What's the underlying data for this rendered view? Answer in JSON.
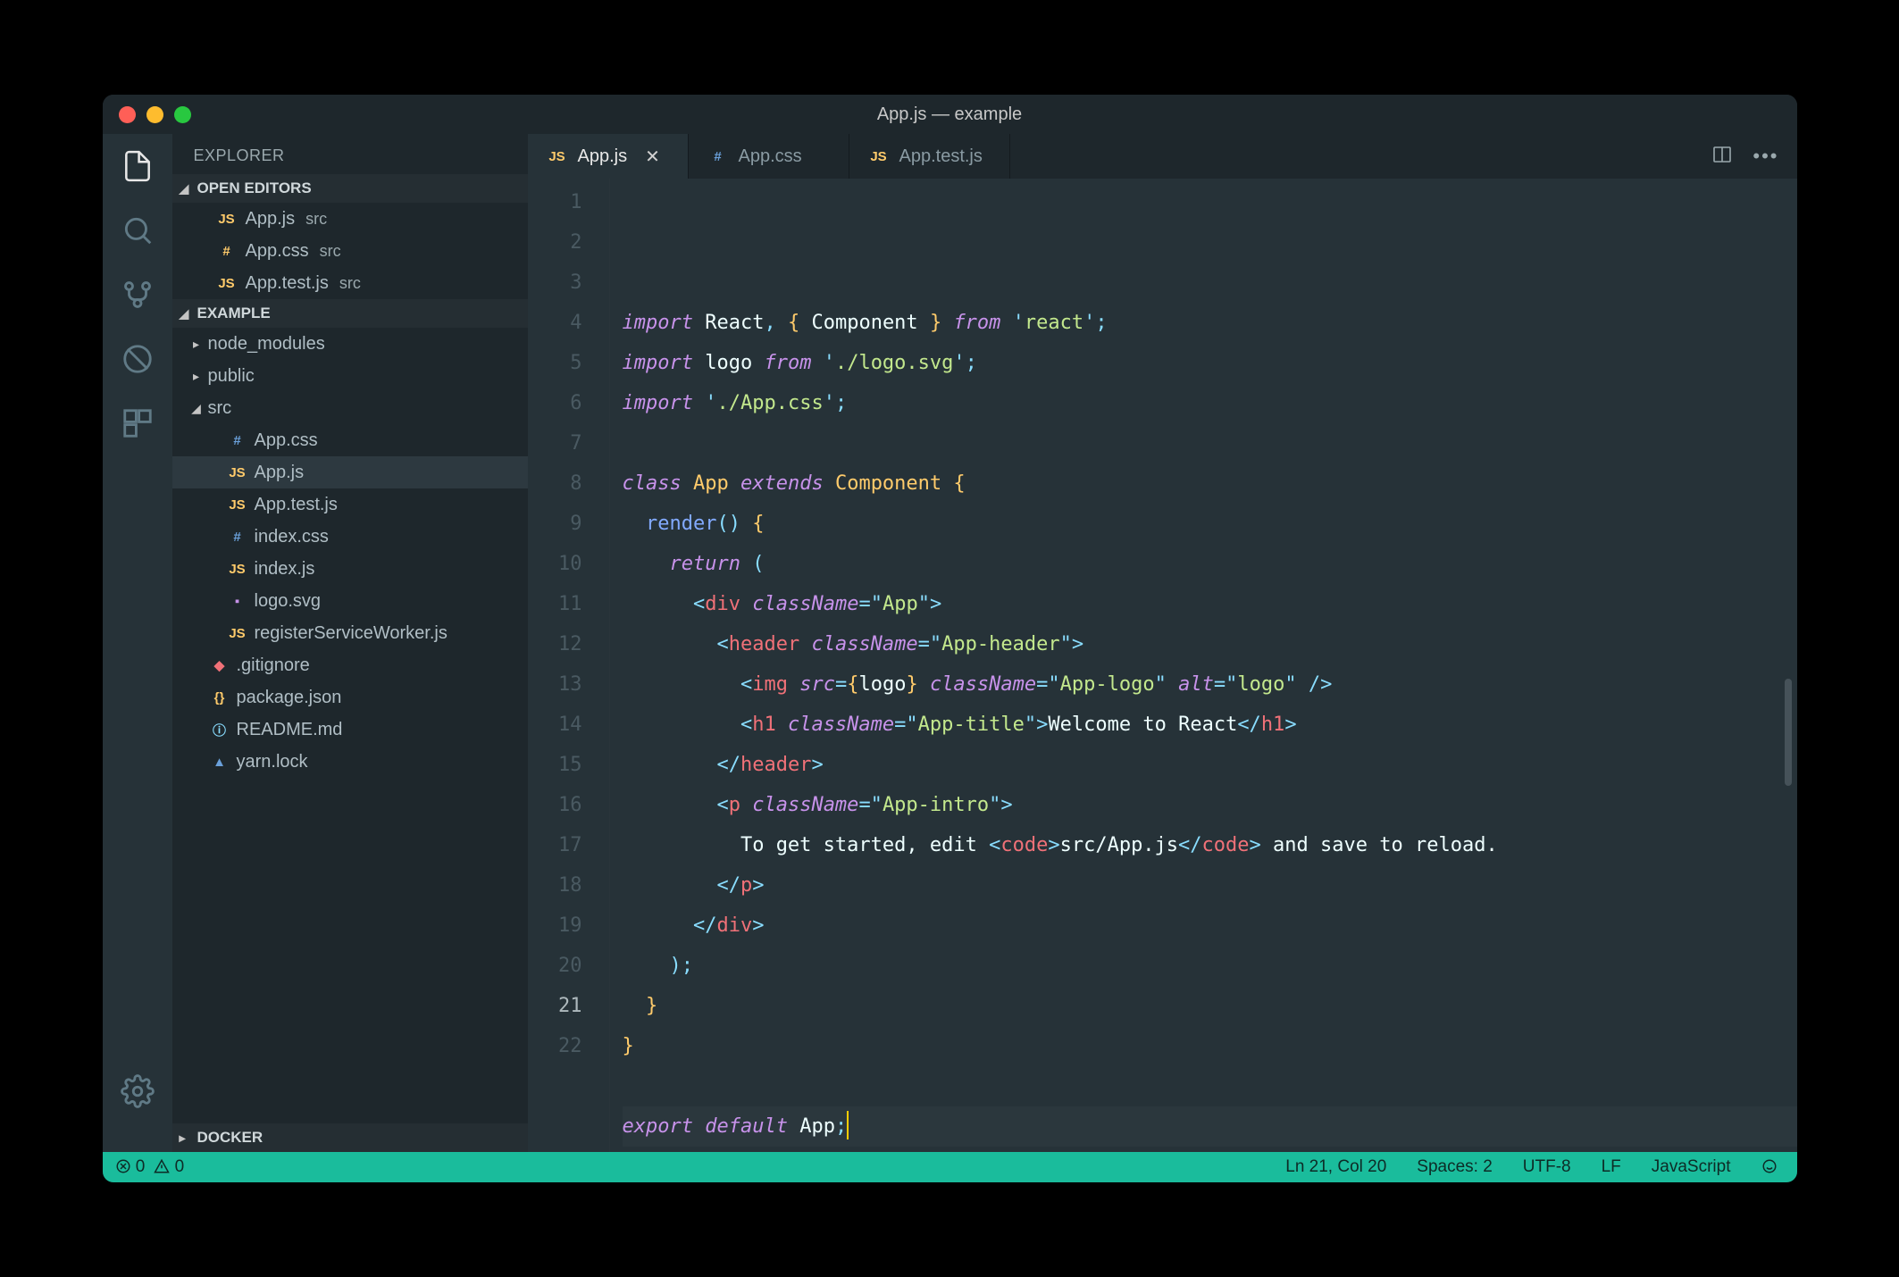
{
  "window_title": "App.js — example",
  "explorer": {
    "title": "EXPLORER",
    "open_editors_label": "OPEN EDITORS",
    "project_label": "EXAMPLE",
    "docker_label": "DOCKER",
    "open_editors": [
      {
        "icon": "JS",
        "name": "App.js",
        "dir": "src"
      },
      {
        "icon": "#",
        "name": "App.css",
        "dir": "src"
      },
      {
        "icon": "JS",
        "name": "App.test.js",
        "dir": "src"
      }
    ],
    "tree_folders": [
      {
        "name": "node_modules",
        "expanded": false
      },
      {
        "name": "public",
        "expanded": false
      },
      {
        "name": "src",
        "expanded": true
      }
    ],
    "src_files": [
      {
        "icon": "#",
        "cls": "css",
        "name": "App.css"
      },
      {
        "icon": "JS",
        "cls": "js",
        "name": "App.js",
        "selected": true
      },
      {
        "icon": "JS",
        "cls": "js",
        "name": "App.test.js"
      },
      {
        "icon": "#",
        "cls": "css",
        "name": "index.css"
      },
      {
        "icon": "JS",
        "cls": "js",
        "name": "index.js"
      },
      {
        "icon": "▪",
        "cls": "svg",
        "name": "logo.svg"
      },
      {
        "icon": "JS",
        "cls": "js",
        "name": "registerServiceWorker.js"
      }
    ],
    "root_files": [
      {
        "icon": "◆",
        "cls": "git",
        "name": ".gitignore"
      },
      {
        "icon": "{}",
        "cls": "json",
        "name": "package.json"
      },
      {
        "icon": "ⓘ",
        "cls": "md",
        "name": "README.md"
      },
      {
        "icon": "▲",
        "cls": "lock",
        "name": "yarn.lock"
      }
    ]
  },
  "tabs": [
    {
      "icon": "JS",
      "cls": "js",
      "label": "App.js",
      "active": true,
      "closable": true
    },
    {
      "icon": "#",
      "cls": "css",
      "label": "App.css",
      "active": false
    },
    {
      "icon": "JS",
      "cls": "js",
      "label": "App.test.js",
      "active": false
    }
  ],
  "line_count": 22,
  "current_line": 21,
  "code_lines": [
    {
      "html": "<span class='tok-kw'>import</span> <span class='tok-def'>React</span><span class='tok-punc'>,</span> <span class='tok-br'>{</span> <span class='tok-def'>Component</span> <span class='tok-br'>}</span> <span class='tok-kw'>from</span> <span class='tok-punc'>'</span><span class='tok-str'>react</span><span class='tok-punc'>'</span><span class='tok-punc'>;</span>"
    },
    {
      "html": "<span class='tok-kw'>import</span> <span class='tok-def'>logo</span> <span class='tok-kw'>from</span> <span class='tok-punc'>'</span><span class='tok-str'>./logo.svg</span><span class='tok-punc'>'</span><span class='tok-punc'>;</span>"
    },
    {
      "html": "<span class='tok-kw'>import</span> <span class='tok-punc'>'</span><span class='tok-str'>./App.css</span><span class='tok-punc'>'</span><span class='tok-punc'>;</span>"
    },
    {
      "html": ""
    },
    {
      "html": "<span class='tok-kw'>class</span> <span class='tok-cls'>App</span> <span class='tok-kw'>extends</span> <span class='tok-cls'>Component</span> <span class='tok-br'>{</span>"
    },
    {
      "html": "  <span class='tok-fn'>render</span><span class='tok-punc'>()</span> <span class='tok-br'>{</span>"
    },
    {
      "html": "    <span class='tok-kw'>return</span> <span class='tok-punc'>(</span>"
    },
    {
      "html": "      <span class='tok-punc'>&lt;</span><span class='tok-tag'>div</span> <span class='tok-attr'>className</span><span class='tok-punc'>=\"</span><span class='tok-str'>App</span><span class='tok-punc'>\"&gt;</span>"
    },
    {
      "html": "        <span class='tok-punc'>&lt;</span><span class='tok-tag'>header</span> <span class='tok-attr'>className</span><span class='tok-punc'>=\"</span><span class='tok-str'>App-header</span><span class='tok-punc'>\"&gt;</span>"
    },
    {
      "html": "          <span class='tok-punc'>&lt;</span><span class='tok-tag'>img</span> <span class='tok-attr'>src</span><span class='tok-punc'>=</span><span class='tok-br'>{</span><span class='tok-def'>logo</span><span class='tok-br'>}</span> <span class='tok-attr'>className</span><span class='tok-punc'>=\"</span><span class='tok-str'>App-logo</span><span class='tok-punc'>\"</span> <span class='tok-attr'>alt</span><span class='tok-punc'>=\"</span><span class='tok-str'>logo</span><span class='tok-punc'>\" /&gt;</span>"
    },
    {
      "html": "          <span class='tok-punc'>&lt;</span><span class='tok-tag'>h1</span> <span class='tok-attr'>className</span><span class='tok-punc'>=\"</span><span class='tok-str'>App-title</span><span class='tok-punc'>\"&gt;</span><span class='tok-txt'>Welcome to React</span><span class='tok-punc'>&lt;/</span><span class='tok-tag'>h1</span><span class='tok-punc'>&gt;</span>"
    },
    {
      "html": "        <span class='tok-punc'>&lt;/</span><span class='tok-tag'>header</span><span class='tok-punc'>&gt;</span>"
    },
    {
      "html": "        <span class='tok-punc'>&lt;</span><span class='tok-tag'>p</span> <span class='tok-attr'>className</span><span class='tok-punc'>=\"</span><span class='tok-str'>App-intro</span><span class='tok-punc'>\"&gt;</span>"
    },
    {
      "html": "          <span class='tok-txt'>To get started, edit </span><span class='tok-punc'>&lt;</span><span class='tok-tag'>code</span><span class='tok-punc'>&gt;</span><span class='tok-txt'>src/App.js</span><span class='tok-punc'>&lt;/</span><span class='tok-tag'>code</span><span class='tok-punc'>&gt;</span><span class='tok-txt'> and save to reload.</span>"
    },
    {
      "html": "        <span class='tok-punc'>&lt;/</span><span class='tok-tag'>p</span><span class='tok-punc'>&gt;</span>"
    },
    {
      "html": "      <span class='tok-punc'>&lt;/</span><span class='tok-tag'>div</span><span class='tok-punc'>&gt;</span>"
    },
    {
      "html": "    <span class='tok-punc'>)</span><span class='tok-punc'>;</span>"
    },
    {
      "html": "  <span class='tok-br'>}</span>"
    },
    {
      "html": "<span class='tok-br'>}</span>"
    },
    {
      "html": ""
    },
    {
      "html": "<span class='tok-kw'>export</span> <span class='tok-kw'>default</span> <span class='tok-def'>App</span><span class='tok-punc'>;</span><span class='caret'></span>",
      "hl": true
    },
    {
      "html": ""
    }
  ],
  "status": {
    "errors": "0",
    "warnings": "0",
    "position": "Ln 21, Col 20",
    "spaces": "Spaces: 2",
    "encoding": "UTF-8",
    "eol": "LF",
    "language": "JavaScript"
  }
}
